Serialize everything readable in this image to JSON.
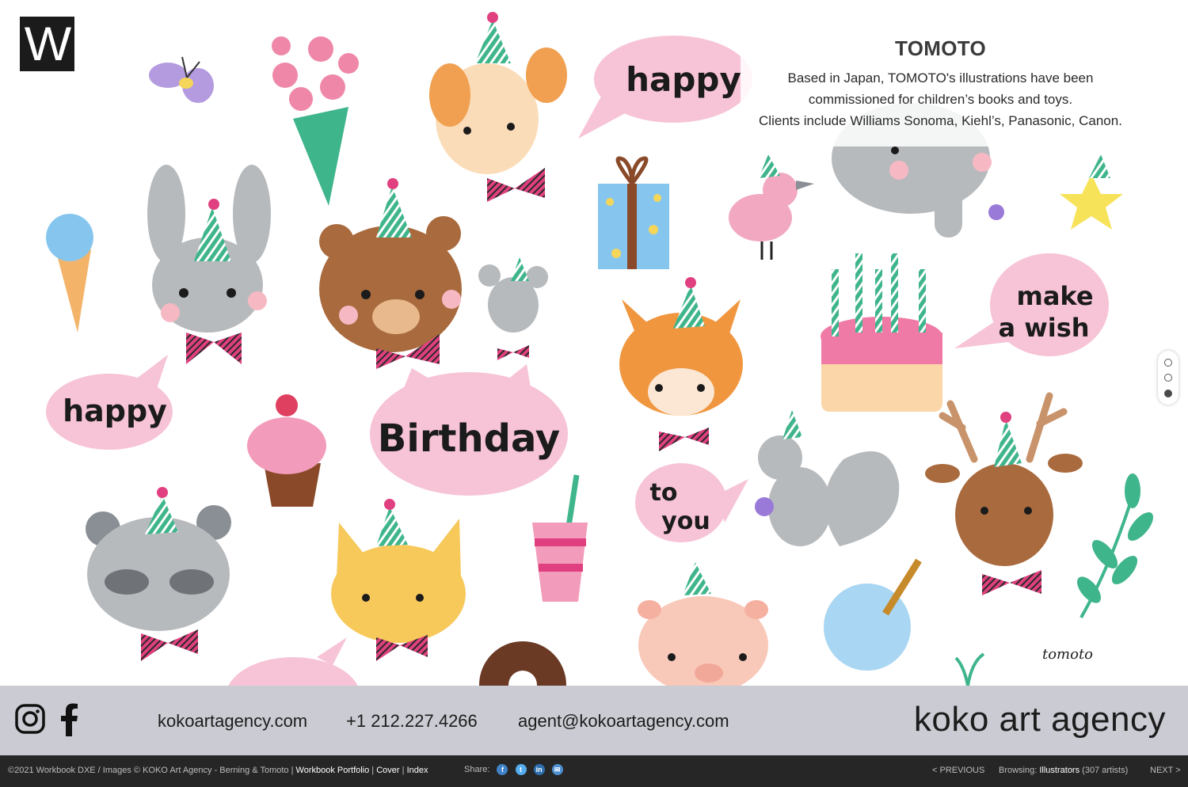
{
  "logo": {
    "letter": "W"
  },
  "artist": {
    "name": "TOMOTO",
    "bio": [
      "Based in Japan, TOMOTO's illustrations have been",
      "commissioned for children’s books and toys.",
      "Clients include Williams Sonoma, Kiehl’s, Panasonic, Canon."
    ]
  },
  "artwork": {
    "bubbles": [
      "happy",
      "make",
      "a wish",
      "happy",
      "Birthday",
      "to",
      "you"
    ],
    "signature": "tomoto"
  },
  "slides": {
    "count": 3,
    "active_index": 2
  },
  "contact": {
    "social": [
      "instagram-icon",
      "facebook-icon"
    ],
    "website": "koko​artagency.com",
    "phone": "+1 212.227.4266",
    "email": "agent@kokoartagency.com",
    "brand": "koko art agency"
  },
  "footer": {
    "copyright": "©2021 Workbook DXE / Images © KOKO Art Agency - Berning & Tomoto |",
    "links": [
      "Workbook Portfolio",
      "Cover",
      "Index"
    ],
    "share_label": "Share:",
    "share_icons": [
      "facebook-icon",
      "twitter-icon",
      "linkedin-icon",
      "email-icon"
    ],
    "previous": "< PREVIOUS",
    "browsing_label": "Browsing:",
    "browsing_category": "Illustrators",
    "browsing_count": "(307 artists)",
    "next": "NEXT >"
  },
  "colors": {
    "contact_bar": "#cbccd3",
    "footer_bar": "#262626",
    "bubble_pink": "#f7c3d6",
    "hat_green": "#3fb58b",
    "bow_pink": "#e0407f"
  }
}
